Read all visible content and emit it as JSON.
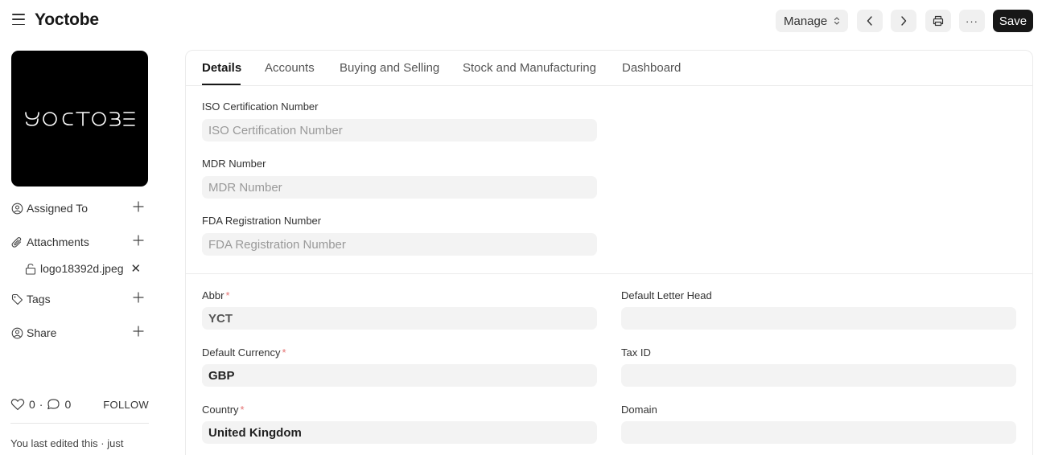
{
  "header": {
    "title": "Yoctobe",
    "manage_label": "Manage",
    "save_label": "Save",
    "more_label": "···"
  },
  "sidebar": {
    "logo_text": "YOCTOBE",
    "assigned_to": "Assigned To",
    "attachments": "Attachments",
    "attachment_file": "logo18392d.jpeg",
    "tags": "Tags",
    "share": "Share",
    "likes": "0",
    "separator": "·",
    "comments": "0",
    "follow": "FOLLOW",
    "last_edited": "You last edited this · just"
  },
  "tabs": [
    {
      "label": "Details"
    },
    {
      "label": "Accounts"
    },
    {
      "label": "Buying and Selling"
    },
    {
      "label": "Stock and Manufacturing"
    },
    {
      "label": "Dashboard"
    }
  ],
  "fields": {
    "iso": {
      "label": "ISO Certification Number",
      "placeholder": "ISO Certification Number"
    },
    "mdr": {
      "label": "MDR Number",
      "placeholder": "MDR Number"
    },
    "fda": {
      "label": "FDA Registration Number",
      "placeholder": "FDA Registration Number"
    },
    "abbr": {
      "label": "Abbr",
      "required": "*",
      "value": "YCT"
    },
    "currency": {
      "label": "Default Currency",
      "required": "*",
      "value": "GBP"
    },
    "country": {
      "label": "Country",
      "required": "*",
      "value": "United Kingdom"
    },
    "letter_head": {
      "label": "Default Letter Head",
      "value": ""
    },
    "tax_id": {
      "label": "Tax ID",
      "value": ""
    },
    "domain": {
      "label": "Domain",
      "value": ""
    }
  }
}
